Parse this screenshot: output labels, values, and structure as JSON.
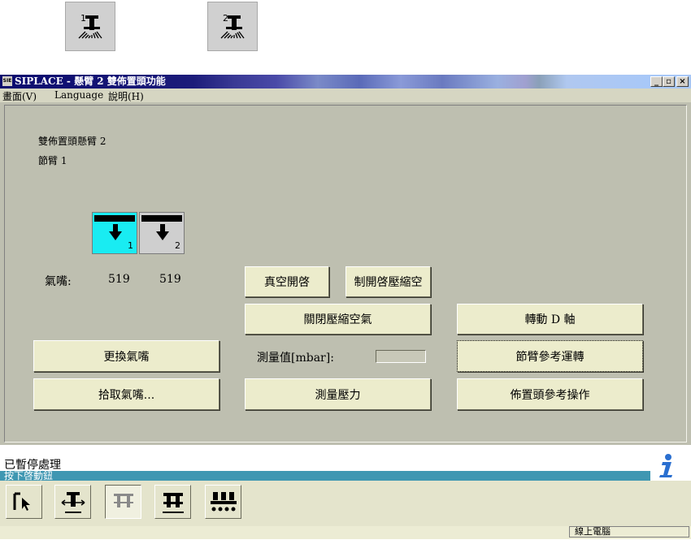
{
  "top_icons": [
    {
      "icon": "gantry-1-head-icon",
      "number": "1"
    },
    {
      "icon": "gantry-2-head-icon",
      "number": "2"
    }
  ],
  "window": {
    "title": "SIPLACE - 懸臂 2 雙佈置頭功能",
    "app_icon_text": "SIE",
    "controls": [
      "_",
      "▫",
      "×"
    ]
  },
  "menu": [
    "畫面(V)",
    "Language",
    "說明(H)"
  ],
  "info": {
    "line1": "雙佈置頭懸臂 2",
    "line2": "節臂 1"
  },
  "nozzles": [
    {
      "number": "1",
      "selected": true,
      "color": "#19ecf2"
    },
    {
      "number": "2",
      "selected": false,
      "color": "#cfcfcf"
    }
  ],
  "nozzle_row": {
    "label": "氣嘴:",
    "value1": "519",
    "value2": "519"
  },
  "buttons": {
    "vacuum_on": "真空開啓",
    "control_air": "制開啓壓縮空",
    "close_air": "關閉壓縮空氣",
    "rotate_d": "轉動 D 軸",
    "change_nozzle": "更換氣嘴",
    "pick_nozzle": "拾取氣嘴...",
    "measure_pressure": "測量壓力",
    "segment_ref": "節臂參考運轉",
    "head_ref": "佈置頭參考操作"
  },
  "measure": {
    "label": "測量值[mbar]:",
    "value": ""
  },
  "status": {
    "line1": "已暫停處理",
    "line2": "按下啓動鈕",
    "pc_label": "線上電腦"
  },
  "toolbar_icons": [
    "pointer-select-icon",
    "single-head-icon",
    "double-head-dim-icon",
    "double-head-icon",
    "multi-head-conveyor-icon"
  ],
  "colors": {
    "window_bg": "#bebfb0",
    "button_bg": "#ececcc",
    "status_bar": "#3f97b2",
    "nozzle_selected": "#19ecf2"
  }
}
